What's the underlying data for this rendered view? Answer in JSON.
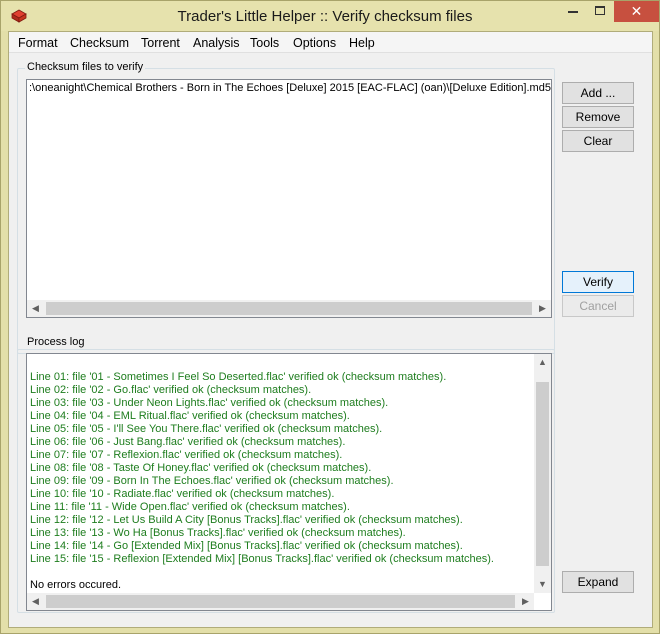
{
  "window": {
    "title": "Trader's Little Helper  ::  Verify checksum files",
    "close_glyph": "✕"
  },
  "menu": [
    "Format",
    "Checksum",
    "Torrent",
    "Analysis",
    "Tools",
    "Options",
    "Help"
  ],
  "checksum_group": {
    "label": "Checksum files to verify",
    "files": [
      ":\\oneanight\\Chemical Brothers - Born in The Echoes [Deluxe] 2015 [EAC-FLAC] (oan)\\[Deluxe Edition].md5"
    ]
  },
  "buttons": {
    "add": "Add ...",
    "remove": "Remove",
    "clear": "Clear",
    "verify": "Verify",
    "cancel": "Cancel",
    "expand": "Expand"
  },
  "process_log": {
    "label": "Process log",
    "lines": [
      "Line 01: file '01 - Sometimes I Feel So Deserted.flac' verified ok (checksum matches).",
      "Line 02: file '02 - Go.flac' verified ok (checksum matches).",
      "Line 03: file '03 - Under Neon Lights.flac' verified ok (checksum matches).",
      "Line 04: file '04 - EML Ritual.flac' verified ok (checksum matches).",
      "Line 05: file '05 - I'll See You There.flac' verified ok (checksum matches).",
      "Line 06: file '06 - Just Bang.flac' verified ok (checksum matches).",
      "Line 07: file '07 - Reflexion.flac' verified ok (checksum matches).",
      "Line 08: file '08 - Taste Of Honey.flac' verified ok (checksum matches).",
      "Line 09: file '09 - Born In The Echoes.flac' verified ok (checksum matches).",
      "Line 10: file '10 - Radiate.flac' verified ok (checksum matches).",
      "Line 11: file '11 - Wide Open.flac' verified ok (checksum matches).",
      "Line 12: file '12 - Let Us Build A City [Bonus Tracks].flac' verified ok (checksum matches).",
      "Line 13: file '13 - Wo Ha [Bonus Tracks].flac' verified ok (checksum matches).",
      "Line 14: file '14 - Go [Extended Mix] [Bonus Tracks].flac' verified ok (checksum matches).",
      "Line 15: file '15 - Reflexion [Extended Mix] [Bonus Tracks].flac' verified ok (checksum matches)."
    ],
    "summary": "No errors occured."
  },
  "colors": {
    "log_ok": "#1e7d1e",
    "frame": "#e3dfa9",
    "close": "#c7503f"
  }
}
